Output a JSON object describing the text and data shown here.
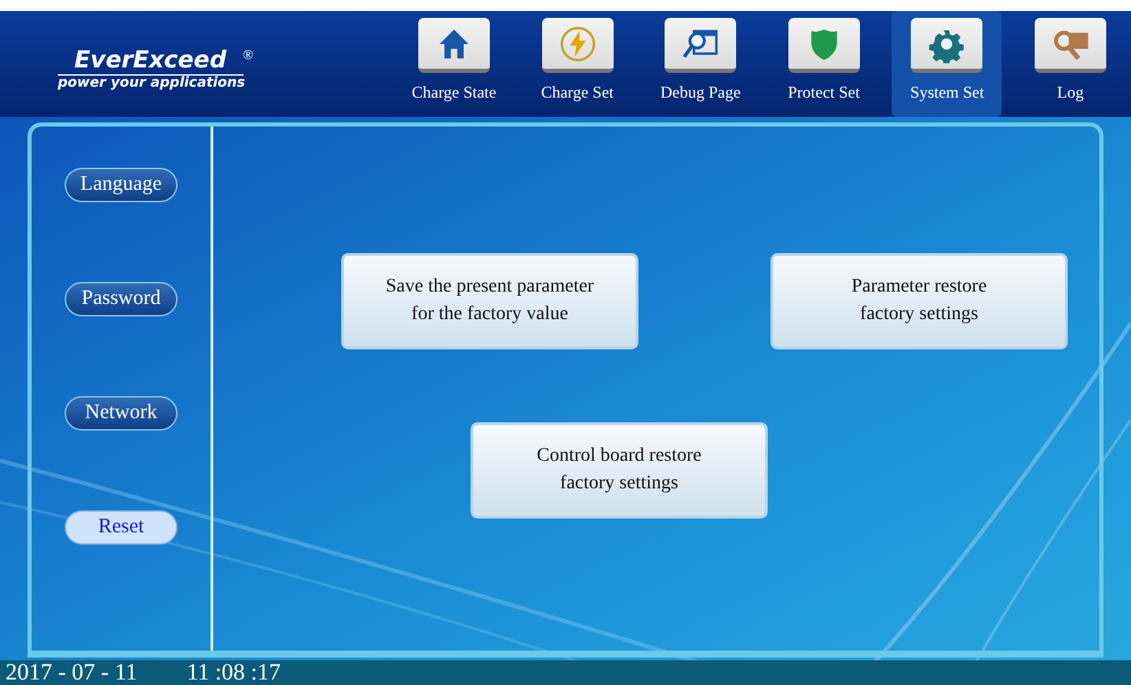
{
  "logo": {
    "brand": "EverExceed",
    "registered": "®",
    "tagline": "power your applications"
  },
  "nav": [
    {
      "label": "Charge State",
      "selected": false
    },
    {
      "label": "Charge Set",
      "selected": false
    },
    {
      "label": "Debug Page",
      "selected": false
    },
    {
      "label": "Protect Set",
      "selected": false
    },
    {
      "label": "System Set",
      "selected": true
    },
    {
      "label": "Log",
      "selected": false
    }
  ],
  "sidebar": [
    {
      "label": "Language",
      "selected": false
    },
    {
      "label": "Password",
      "selected": false
    },
    {
      "label": "Network",
      "selected": false
    },
    {
      "label": "Reset",
      "selected": true
    }
  ],
  "actions": [
    {
      "label": "Save the present parameter\nfor the factory value"
    },
    {
      "label": "Parameter restore\nfactory settings"
    },
    {
      "label": "Control board restore\nfactory settings"
    }
  ],
  "status_bar": {
    "date": "2017 - 07 - 11",
    "time": "11 :08 :17"
  }
}
